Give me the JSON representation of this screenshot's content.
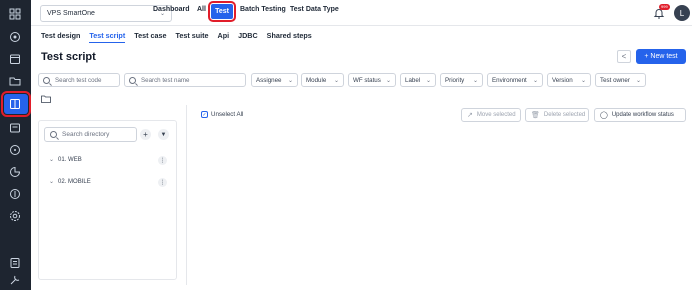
{
  "sidebar": {
    "icons": [
      "grid-icon",
      "target-icon",
      "calendar-icon",
      "folder-icon",
      "test-script-icon",
      "layers-icon",
      "compass-icon",
      "chart-icon",
      "report-icon",
      "settings-icon",
      "notes-icon",
      "tools-icon"
    ]
  },
  "topbar": {
    "project": "VPS SmartOne",
    "nav": [
      "Dashboard",
      "All",
      "Test",
      "Batch Testing",
      "Test Data Type"
    ],
    "notification_count": "999",
    "avatar_initial": "L"
  },
  "tabs": [
    "Test design",
    "Test script",
    "Test case",
    "Test suite",
    "Api",
    "JDBC",
    "Shared steps"
  ],
  "active_tab": "Test script",
  "page": {
    "title": "Test script",
    "back_label": "<",
    "new_test_label": "+ New test"
  },
  "filters": {
    "search_code_placeholder": "Search test code",
    "search_name_placeholder": "Search test name",
    "dropdowns": [
      "Assignee",
      "Module",
      "WF status",
      "Label",
      "Priority",
      "Environment",
      "Version",
      "Test owner"
    ]
  },
  "directory": {
    "search_placeholder": "Search directory",
    "add_label": "+",
    "items": [
      "01. WEB",
      "02. MOBILE"
    ]
  },
  "actions": {
    "unselect_all": "Unselect All",
    "move_selected": "Move selected",
    "delete_selected": "Delete selected",
    "update_workflow_status": "Update workflow status"
  },
  "colors": {
    "sidebar_bg": "#1e2530",
    "accent": "#2563eb",
    "highlight_outline": "#e11d2a"
  }
}
